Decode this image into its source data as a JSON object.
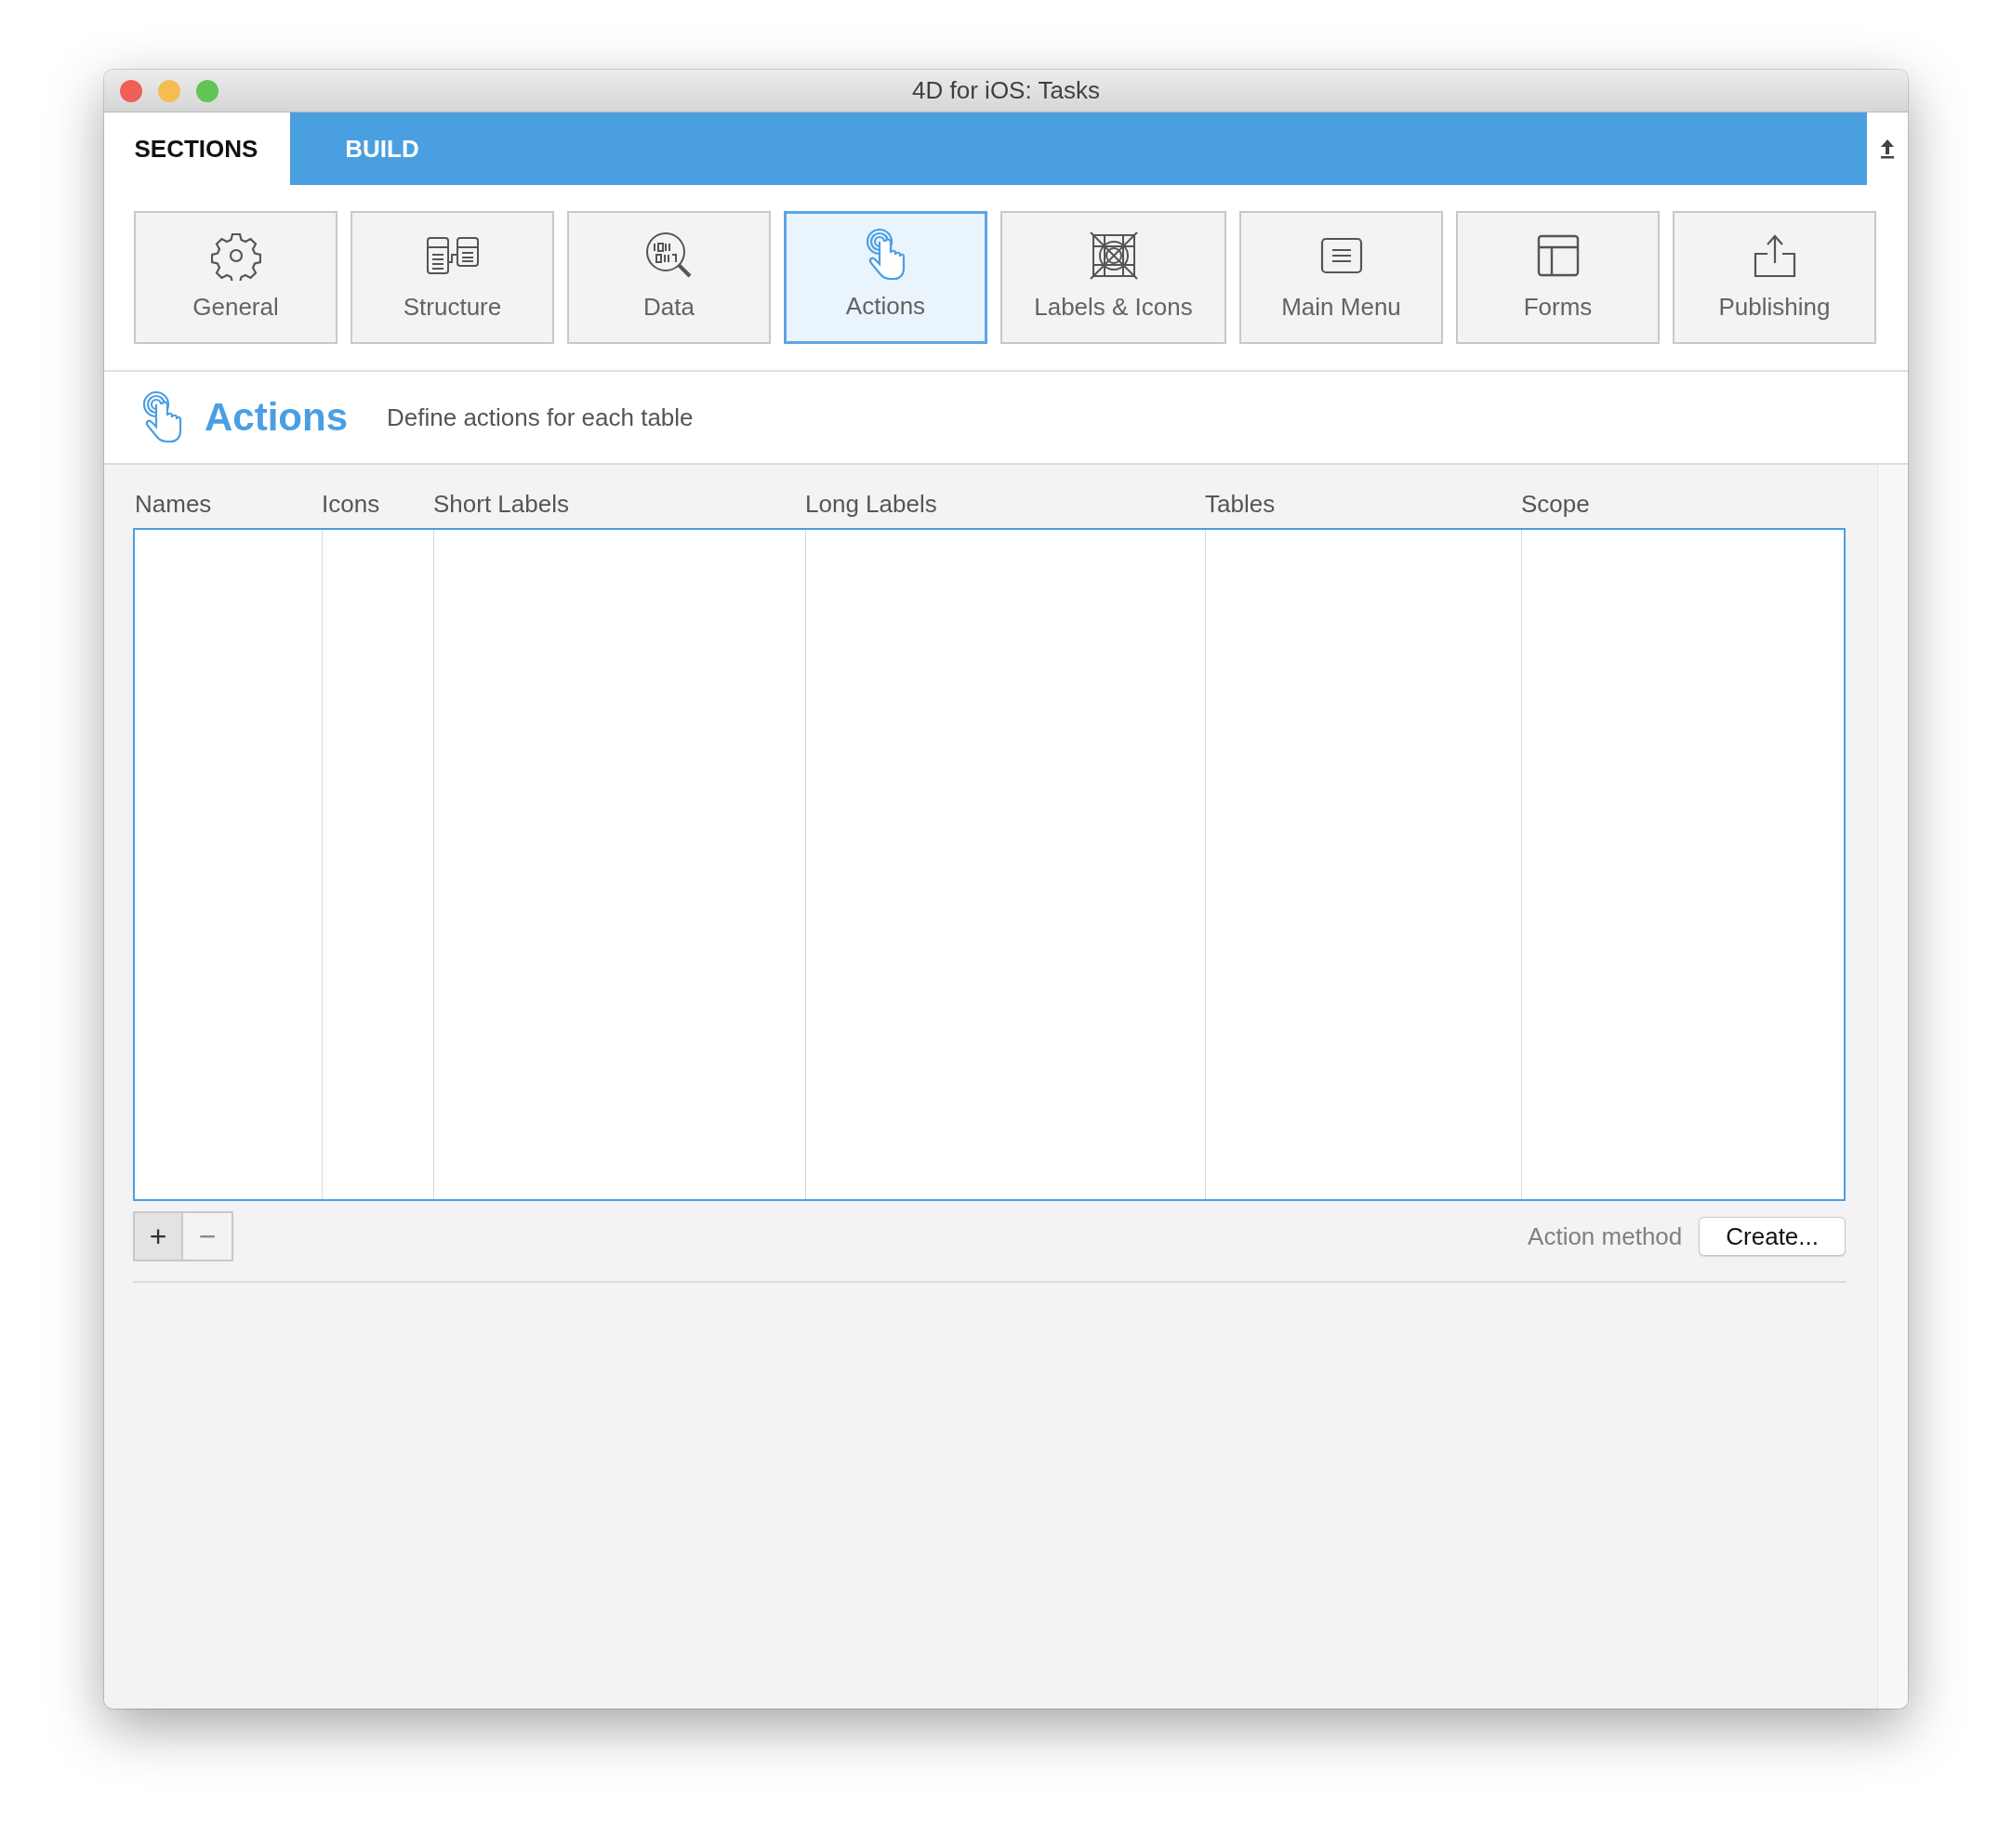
{
  "window": {
    "title": "4D for iOS: Tasks"
  },
  "tabs": [
    {
      "label": "SECTIONS",
      "selected": true
    },
    {
      "label": "BUILD",
      "selected": false
    }
  ],
  "sections": [
    {
      "label": "General",
      "selected": false
    },
    {
      "label": "Structure",
      "selected": false
    },
    {
      "label": "Data",
      "selected": false
    },
    {
      "label": "Actions",
      "selected": true
    },
    {
      "label": "Labels & Icons",
      "selected": false
    },
    {
      "label": "Main Menu",
      "selected": false
    },
    {
      "label": "Forms",
      "selected": false
    },
    {
      "label": "Publishing",
      "selected": false
    }
  ],
  "header": {
    "title": "Actions",
    "subtitle": "Define actions for each table"
  },
  "table": {
    "columns": [
      "Names",
      "Icons",
      "Short Labels",
      "Long Labels",
      "Tables",
      "Scope"
    ]
  },
  "footer": {
    "buttons": [
      {
        "label": "+",
        "disabled": false
      },
      {
        "label": "−",
        "disabled": true
      }
    ],
    "method_label": "Action method",
    "create_button": "Create..."
  }
}
